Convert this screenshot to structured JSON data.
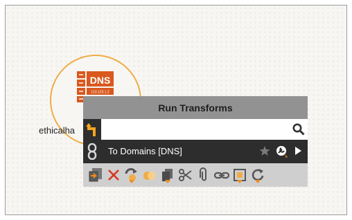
{
  "entity": {
    "icon_title": "DNS",
    "icon_ip": "123.123.1.2",
    "label": "ethicalha"
  },
  "popup": {
    "title": "Run Transforms",
    "search_placeholder": "",
    "search_value": "",
    "transform_item": "To Domains [DNS]"
  },
  "toolbar": {
    "icons": [
      "import-icon",
      "delete-icon",
      "change-type-icon",
      "merge-icon",
      "copy-icon",
      "cut-icon",
      "attach-icon",
      "link-icon",
      "select-icon",
      "refresh-icon"
    ]
  },
  "colors": {
    "accent": "#f08c1f",
    "popup_header": "#929292",
    "dark_row": "#2d2d2d",
    "entity_border": "#f0ac45"
  }
}
